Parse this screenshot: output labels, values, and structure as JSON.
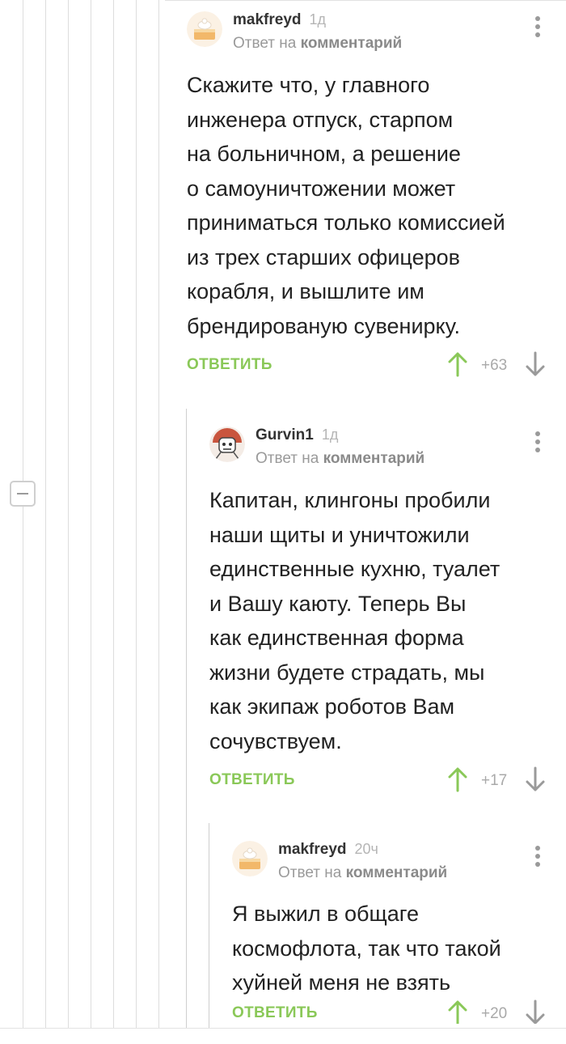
{
  "common": {
    "reply_to_prefix": "Ответ на",
    "reply_to_link": "комментарий",
    "reply_label": "ОТВЕТИТЬ"
  },
  "colors": {
    "accent_green": "#8ac858",
    "thread_line": "#dddddd",
    "muted_text": "#9a9a9a"
  },
  "comments": [
    {
      "username": "makfreyd",
      "time": "1д",
      "avatar": "cake-avatar",
      "body_lines": [
        "Скажите что, у главного",
        "инженера отпуск, старпом",
        "на больничном, а решение",
        "о самоуничтожении может",
        "приниматься только комиссией",
        "из трех старших офицеров",
        "корабля, и вышлите им",
        "брендированую сувенирку."
      ],
      "rating": "+63"
    },
    {
      "username": "Gurvin1",
      "time": "1д",
      "avatar": "robot-avatar",
      "body_lines": [
        "Капитан, клингоны пробили",
        "наши щиты и уничтожили",
        "единственные кухню, туалет",
        "и Вашу каюту. Теперь Вы",
        "как единственная форма",
        "жизни будете страдать, мы",
        "как экипаж роботов Вам",
        "сочувствуем."
      ],
      "rating": "+17"
    },
    {
      "username": "makfreyd",
      "time": "20ч",
      "avatar": "cake-avatar",
      "body_lines": [
        "Я выжил в общаге",
        "космофлота, так что такой",
        "хуйней меня не взять"
      ],
      "rating": "+20"
    }
  ]
}
